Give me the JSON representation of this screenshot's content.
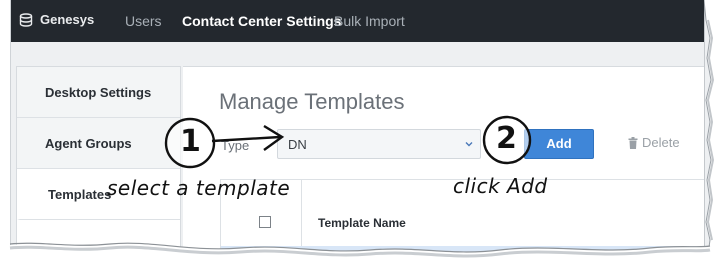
{
  "navbar": {
    "brand": "Genesys",
    "items": [
      {
        "label": "Users",
        "active": false
      },
      {
        "label": "Contact Center Settings",
        "active": true
      },
      {
        "label": "Bulk Import",
        "active": false
      }
    ]
  },
  "sidebar": {
    "items": [
      {
        "label": "Desktop Settings",
        "active": false
      },
      {
        "label": "Agent Groups",
        "active": false
      },
      {
        "label": "Templates",
        "active": true
      }
    ]
  },
  "main": {
    "title": "Manage Templates",
    "type_label": "Type",
    "type_select_value": "DN",
    "add_label": "Add",
    "delete_label": "Delete"
  },
  "table": {
    "columns": [
      "Template Name"
    ]
  },
  "annotations": {
    "step1_number": "1",
    "step1_text": "select a template",
    "step2_number": "2",
    "step2_text": "click Add"
  },
  "colors": {
    "navbar_bg": "#23282e",
    "accent": "#3f86d8",
    "selected_row": "#d8e6f7"
  }
}
